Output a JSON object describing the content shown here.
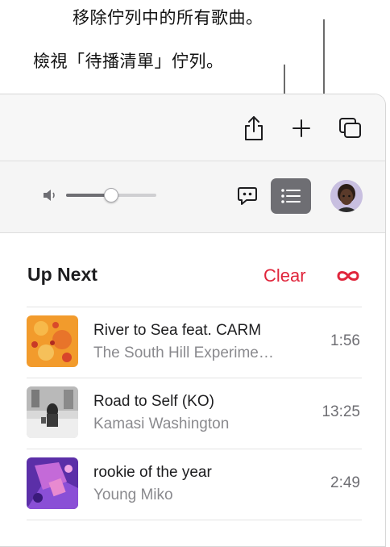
{
  "callouts": {
    "clear_queue": "移除佇列中的所有歌曲。",
    "view_queue": "檢視「待播清單」佇列。"
  },
  "toolbar": {
    "volume_level": 0.5
  },
  "up_next": {
    "title": "Up Next",
    "clear_label": "Clear",
    "songs": [
      {
        "title": "River to Sea feat. CARM",
        "artist": "The South Hill Experime…",
        "duration": "1:56"
      },
      {
        "title": "Road to Self (KO)",
        "artist": "Kamasi Washington",
        "duration": "13:25"
      },
      {
        "title": "rookie of the year",
        "artist": "Young Miko",
        "duration": "2:49"
      }
    ]
  },
  "colors": {
    "accent": "#e0263c",
    "queue_button_bg": "#6e6e73"
  }
}
